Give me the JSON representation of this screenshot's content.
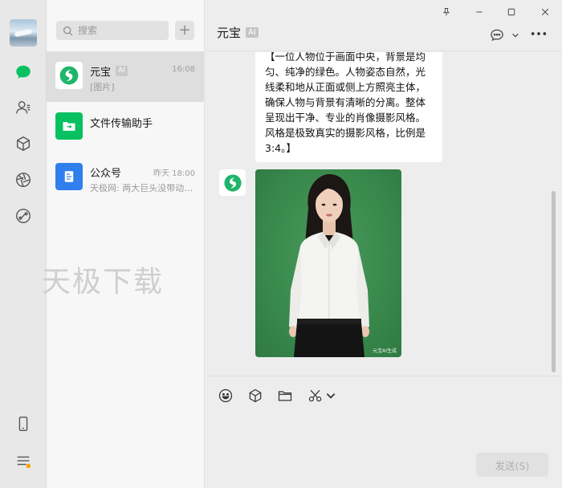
{
  "search": {
    "placeholder": "搜索"
  },
  "chats": [
    {
      "name": "元宝",
      "badge": "AI",
      "preview": "[图片]",
      "time": "16:08"
    },
    {
      "name": "文件传输助手",
      "preview": "",
      "time": ""
    },
    {
      "name": "公众号",
      "preview": "天极网: 两大巨头没带动…",
      "time": "昨天 18:00"
    }
  ],
  "watermark": "天极下载",
  "conversation": {
    "title": "元宝",
    "badge": "AI",
    "message_text": "【一位人物位于画面中央，背景是均匀、纯净的绿色。人物姿态自然，光线柔和地从正面或侧上方照亮主体，确保人物与背景有清晰的分离。整体呈现出干净、专业的肖像摄影风格。风格是极致真实的摄影风格，比例是3:4。】",
    "image_tag": "元宝AI生成"
  },
  "composer": {
    "send_label": "发送(S)"
  },
  "colors": {
    "accent_green": "#07c160",
    "yuanbao_green": "#1fb56a",
    "official_blue": "#2f80ed"
  }
}
